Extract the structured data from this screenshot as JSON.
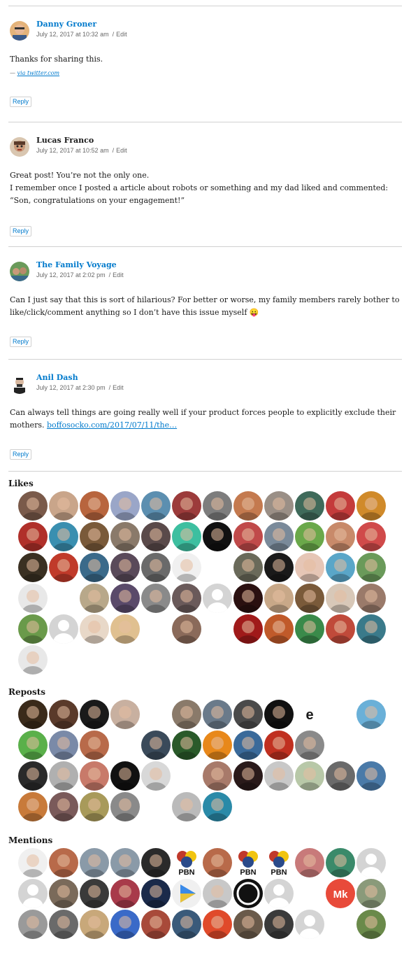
{
  "comments": [
    {
      "author": "Danny Groner",
      "author_is_link": true,
      "date": "July 12, 2017 at 10:32 am",
      "edit": "Edit",
      "body": [
        "Thanks for sharing this."
      ],
      "via_prefix": "— ",
      "via_link": "via twitter.com",
      "reply": "Reply",
      "avatar_color": "#c98a4b"
    },
    {
      "author": "Lucas Franco",
      "author_is_link": false,
      "date": "July 12, 2017 at 10:52 am",
      "edit": "Edit",
      "body": [
        "Great post! You’re not the only one.",
        "I remember once I posted a article about robots or something and my dad liked and commented: “Son, congratulations on your engagement!”"
      ],
      "reply": "Reply",
      "avatar_color": "#b55c4a"
    },
    {
      "author": "The Family Voyage",
      "author_is_link": true,
      "date": "July 12, 2017 at 2:02 pm",
      "edit": "Edit",
      "body": [
        "Can I just say that this is sort of hilarious? For better or worse, my family members rarely bother to like/click/comment anything so I don’t have this issue myself 😛"
      ],
      "reply": "Reply",
      "avatar_color": "#5e8a5a"
    },
    {
      "author": "Anil Dash",
      "author_is_link": true,
      "date": "July 12, 2017 at 2:30 pm",
      "edit": "Edit",
      "body_text": "Can always tell things are going really well if your product forces people to explicitly exclude their mothers. ",
      "body_link": "boffosocko.com/2017/07/11/the…",
      "reply": "Reply",
      "avatar_color": "#e9e9e9"
    }
  ],
  "likes": {
    "title": "Likes",
    "rows": [
      [
        "#7a5a4a",
        "#c9a58a",
        "#b8653e",
        "#9aa6c8",
        "#5c8fb0",
        "#9c3b3b",
        "#7d7d7d",
        "#c47a4f",
        "#9a8f86",
        "#3f6a5a",
        "#c43b3b",
        "#d08a2a"
      ],
      [
        "#b0302a",
        "#3a8fb0",
        "#7a5a3a",
        "#8a7a6a",
        "#5a4a4a",
        "#3dbfa0",
        "#111111",
        "#c04a4a",
        "#7a8a9a",
        "#6aa84a",
        "#c88a6a",
        "#d04a4a"
      ],
      [
        "#3a3022",
        "#c03a2a",
        "#3a6a8a",
        "#5a4a5a",
        "#6a6a6a",
        "#f0f0f0",
        null,
        "#6a6a5a",
        "#1a1a1a",
        "#e6c6b6",
        "#5aa6c8",
        "#6a9a5a"
      ],
      [
        "#e8e8e8",
        null,
        "#b8a88a",
        "#5a4a6a",
        "#8a8a8a",
        "#6a5a5a",
        "#d4d4d4",
        "#2a1010",
        "#c8a888",
        "#7a5a3a",
        "#d8c8b8",
        "#9a7a6a"
      ],
      [
        "#6a9a4a",
        "#d4d4d4",
        "#e8d8c8",
        "#e0c090",
        null,
        "#8a6a5a",
        null,
        "#a01a1a",
        "#c05a2a",
        "#3a8a4a",
        "#c04a3a",
        "#3a7a8a"
      ],
      [
        "#e8e8e8"
      ]
    ]
  },
  "reposts": {
    "title": "Reposts",
    "rows": [
      [
        "#3a2a1a",
        "#5a3a2a",
        "#1a1a1a",
        "#c8b0a0",
        null,
        "#8a7a6a",
        "#6a7a8a",
        "#4a4a4a",
        "#111111",
        "#ffffff",
        null,
        "#6ab0d8"
      ],
      [
        "#5ab04a",
        "#7a8aa8",
        "#b86a4a",
        null,
        "#3a4a5a",
        "#2a5a2a",
        "#e8881a",
        "#3a6a9a",
        "#c03020",
        "#8a8a8a",
        null,
        null
      ],
      [
        "#2a2a2a",
        "#b0b0b0",
        "#c87a6a",
        "#111111",
        "#d8d8d8",
        null,
        "#a87a6a",
        "#2a1a1a",
        "#c8c8c8",
        "#b8c8a8",
        "#6a6a6a",
        "#4a7aa8"
      ],
      [
        "#c87a3a",
        "#7a5a5a",
        "#a89a5a",
        "#8a8a8a",
        null,
        "#bababa",
        "#2a8aa8"
      ]
    ]
  },
  "mentions": {
    "title": "Mentions",
    "rows": [
      [
        "#f0f0f0",
        "#b86a4a",
        "#8a9aa8",
        "#8a9aa8",
        "#2a2a2a",
        "#2a4a8a",
        "#b86a4a",
        "#2a4a8a",
        "#2a4a8a",
        "#c87a7a",
        "#3a8a6a",
        "#d4d4d4"
      ],
      [
        "#d4d4d4",
        "#7a6a5a",
        "#3a3a3a",
        "#a83a4a",
        "#1a2a4a",
        "#f0f0f0",
        "#c8c8c8",
        "#111111",
        "#d4d4d4",
        null,
        "#e84a3a",
        "#8a9a7a"
      ],
      [
        "#9a9a9a",
        "#6a6a6a",
        "#c8a87a",
        "#3a6ac8",
        "#a84a3a",
        "#3a5a7a",
        "#e04a2a",
        "#6a5a4a",
        "#3a3a3a",
        "#d4d4d4",
        null,
        "#6a8a4a"
      ]
    ],
    "pbn_label": "PBN",
    "mk_label": "Mk"
  }
}
